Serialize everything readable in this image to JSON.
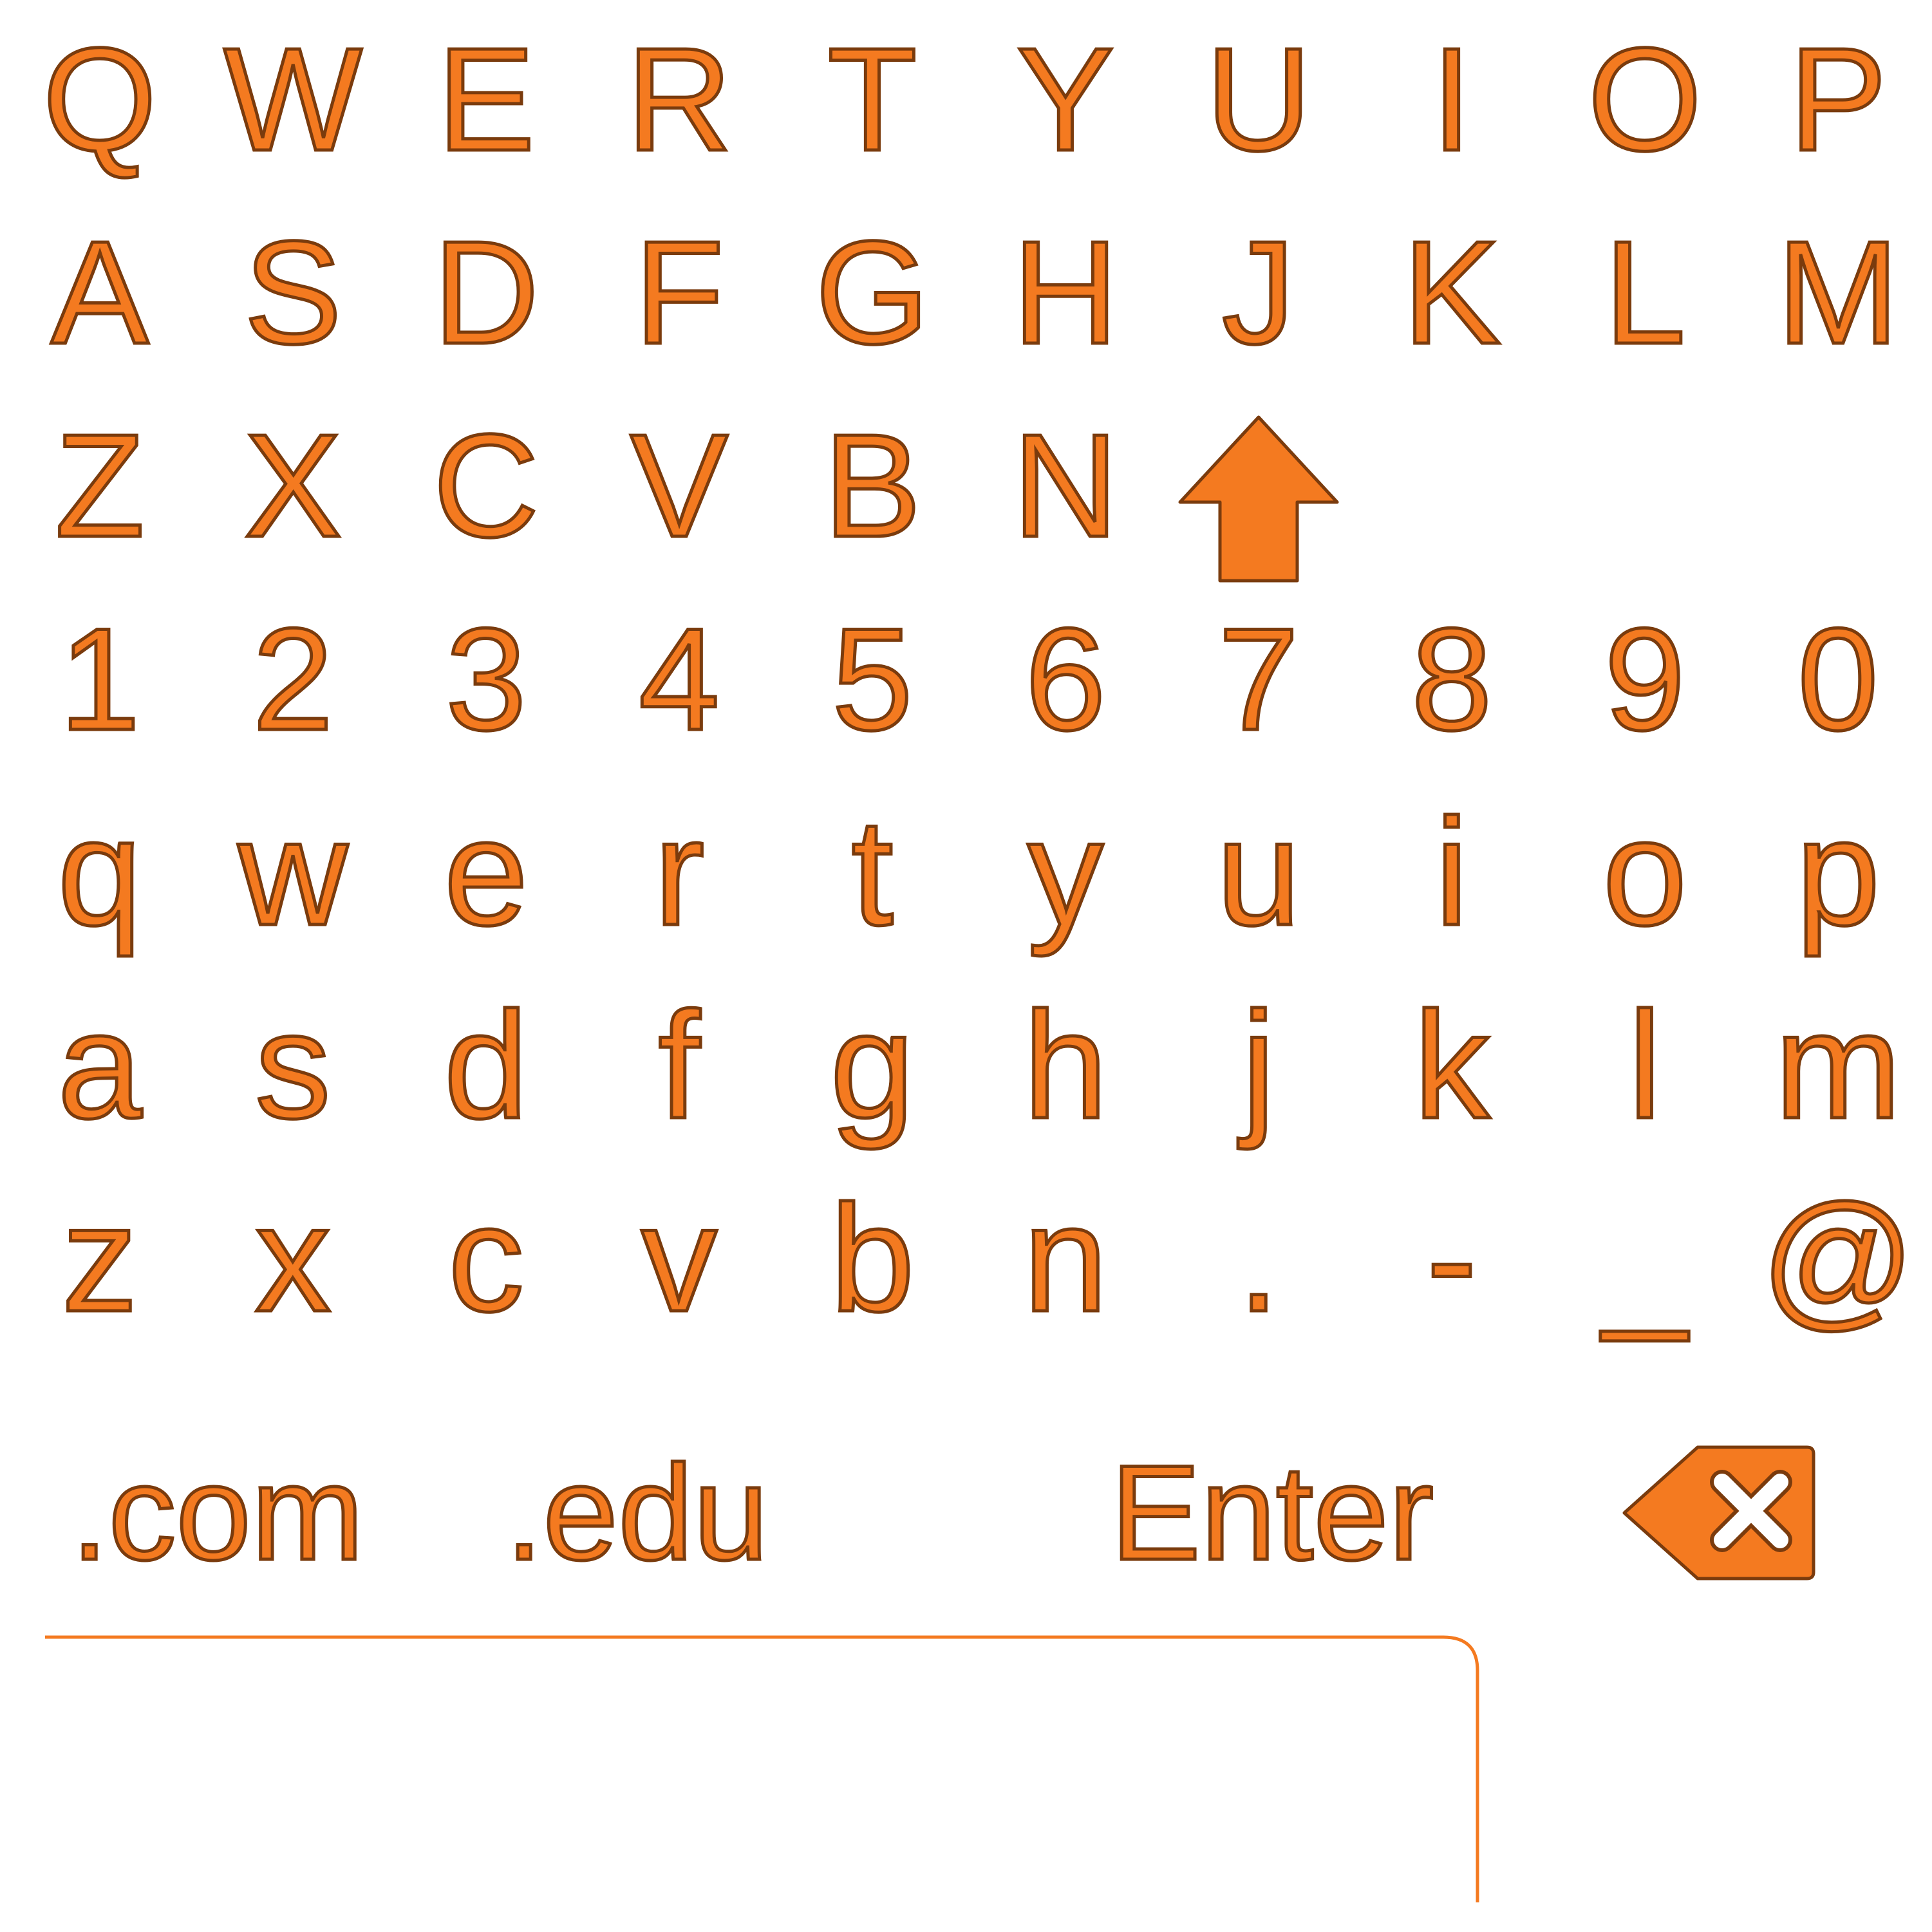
{
  "colors": {
    "accent": "#f47a20",
    "outline": "#7a3b0d",
    "background": "#ffffff"
  },
  "keyboard": {
    "row_upper_1": [
      "Q",
      "W",
      "E",
      "R",
      "T",
      "Y",
      "U",
      "I",
      "O",
      "P"
    ],
    "row_upper_2": [
      "A",
      "S",
      "D",
      "F",
      "G",
      "H",
      "J",
      "K",
      "L",
      "M"
    ],
    "row_upper_3": [
      "Z",
      "X",
      "C",
      "V",
      "B",
      "N"
    ],
    "shift_icon": "shift-arrow-up-icon",
    "row_numbers": [
      "1",
      "2",
      "3",
      "4",
      "5",
      "6",
      "7",
      "8",
      "9",
      "0"
    ],
    "row_lower_1": [
      "q",
      "w",
      "e",
      "r",
      "t",
      "y",
      "u",
      "i",
      "o",
      "p"
    ],
    "row_lower_2": [
      "a",
      "s",
      "d",
      "f",
      "g",
      "h",
      "j",
      "k",
      "l",
      "m"
    ],
    "row_lower_3": [
      "z",
      "x",
      "c",
      "v",
      "b",
      "n",
      ".",
      "-",
      "_",
      "@"
    ],
    "bottom": {
      "com_label": ".com",
      "edu_label": ".edu",
      "enter_label": "Enter",
      "backspace_icon": "backspace-icon"
    }
  },
  "input": {
    "value": "",
    "placeholder": ""
  }
}
